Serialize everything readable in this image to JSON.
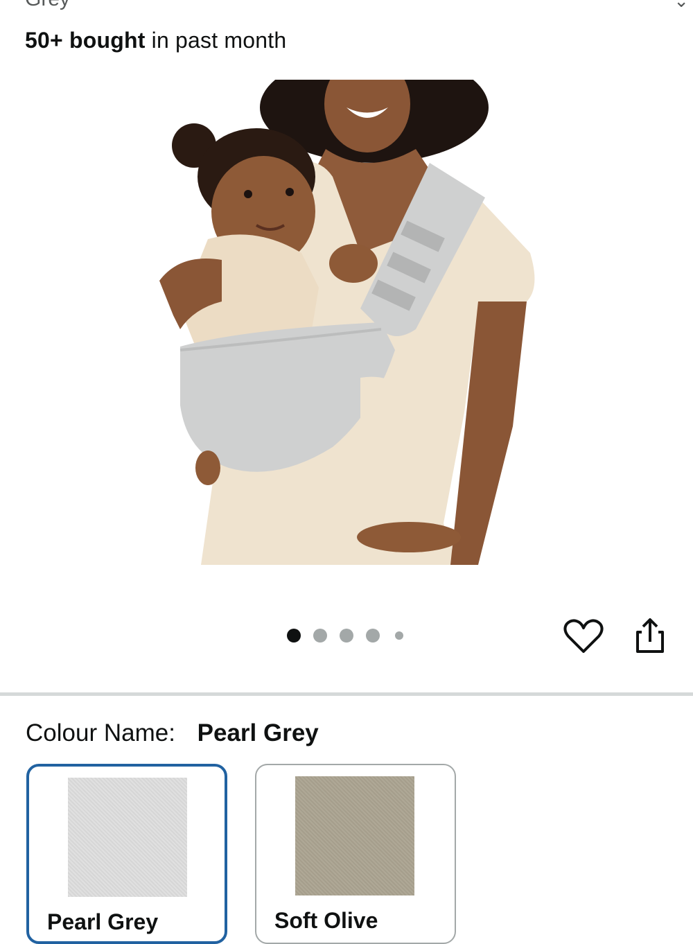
{
  "header": {
    "variant_cut_text": "Grey",
    "bought_bold": "50+ bought",
    "bought_rest": " in past month"
  },
  "gallery": {
    "image_alt": "Person wearing a light grey baby sling carrying a toddler",
    "dots_count": 5,
    "active_dot": 1
  },
  "actions": {
    "wishlist_icon": "heart-icon",
    "share_icon": "share-icon"
  },
  "colour": {
    "label": "Colour Name:",
    "value": "Pearl Grey",
    "options": [
      {
        "name": "Pearl Grey",
        "swatch_color": "#dcdcdc",
        "selected": true
      },
      {
        "name": "Soft Olive",
        "swatch_color": "#aaa391",
        "selected": false
      }
    ]
  },
  "colors": {
    "accent_selected_border": "#2162a1",
    "dot_active": "#0f1111",
    "dot_inactive": "#a3a8a8",
    "sling_grey": "#cfd0d0",
    "shirt_cream": "#efe3cf"
  }
}
